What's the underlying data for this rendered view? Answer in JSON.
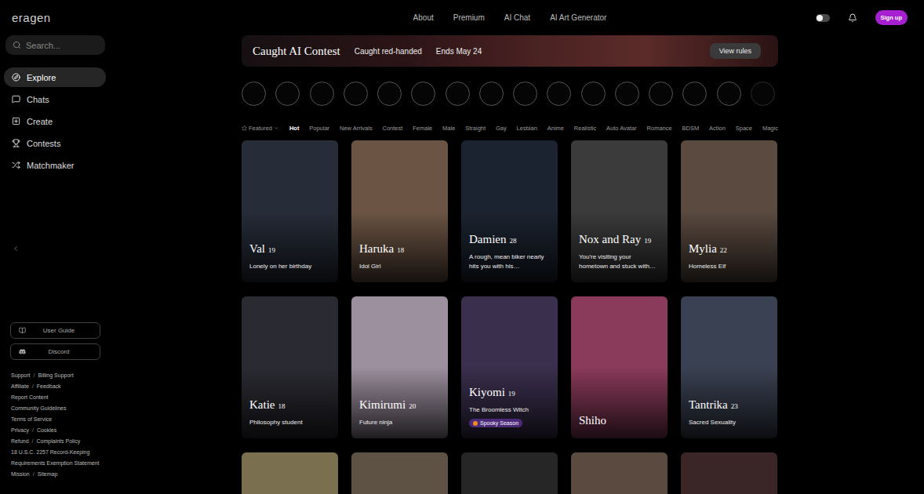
{
  "header": {
    "logo": "eragen",
    "nav": [
      "About",
      "Premium",
      "AI Chat",
      "AI Art Generator"
    ],
    "dark_mode": true,
    "signup": "Sign up"
  },
  "sidebar": {
    "search_placeholder": "Search...",
    "items": [
      {
        "label": "Explore",
        "selected": true
      },
      {
        "label": "Chats",
        "selected": false
      },
      {
        "label": "Create",
        "selected": false
      },
      {
        "label": "Contests",
        "selected": false
      },
      {
        "label": "Matchmaker",
        "selected": false
      }
    ],
    "buttons": [
      "User Guide",
      "Discord"
    ],
    "footer": {
      "separator": "/",
      "rows": [
        [
          "Support",
          "Billing Support"
        ],
        [
          "Affiliate",
          "Feedback"
        ],
        [
          "Report Content"
        ],
        [
          "Community Guidelines"
        ],
        [
          "Terms of Service"
        ],
        [
          "Privacy",
          "Cookies"
        ],
        [
          "Refund",
          "Complaints Policy"
        ],
        [
          "18 U.S.C. 2257 Record-Keeping Requirements Exemption Statement"
        ],
        [
          "Mission",
          "Sitemap"
        ]
      ]
    }
  },
  "banner": {
    "title": "Caught AI Contest",
    "subtitle": "Caught red-handed",
    "ends": "Ends May 24",
    "button": "View rules"
  },
  "avatar_circles": 16,
  "filters": {
    "sort": "Featured",
    "tabs": [
      {
        "label": "Hot",
        "selected": true
      },
      {
        "label": "Popular",
        "selected": false
      },
      {
        "label": "New Arrivals",
        "selected": false
      },
      {
        "label": "Contest",
        "selected": false
      },
      {
        "label": "Female",
        "selected": false
      },
      {
        "label": "Male",
        "selected": false
      },
      {
        "label": "Straight",
        "selected": false
      },
      {
        "label": "Gay",
        "selected": false
      },
      {
        "label": "Lesbian",
        "selected": false
      },
      {
        "label": "Anime",
        "selected": false
      },
      {
        "label": "Realistic",
        "selected": false
      },
      {
        "label": "Auto Avatar",
        "selected": false
      },
      {
        "label": "Romance",
        "selected": false
      },
      {
        "label": "BDSM",
        "selected": false
      },
      {
        "label": "Action",
        "selected": false
      },
      {
        "label": "Space",
        "selected": false
      },
      {
        "label": "Magic",
        "selected": false
      }
    ]
  },
  "cards": [
    {
      "kind": "character",
      "name": "Val",
      "age": "19",
      "description": "Lonely on her birthday"
    },
    {
      "kind": "character",
      "name": "Haruka",
      "age": "18",
      "description": "Idol Girl"
    },
    {
      "kind": "character",
      "name": "Damien",
      "age": "28",
      "description": "A rough, mean biker nearly hits you with his…"
    },
    {
      "kind": "character",
      "name": "Nox and Ray",
      "age": "19",
      "description": "You're visiting your hometown and stuck with…"
    },
    {
      "kind": "character",
      "name": "Mylia",
      "age": "22",
      "description": "Homeless Elf"
    },
    {
      "kind": "character",
      "name": "Katie",
      "age": "18",
      "description": "Philosophy student"
    },
    {
      "kind": "character",
      "name": "Kimirumi",
      "age": "20",
      "description": "Future ninja"
    },
    {
      "kind": "character",
      "name": "Kiyomi",
      "age": "19",
      "description": "The Broomless Witch",
      "badge": "Spooky Season"
    },
    {
      "kind": "character",
      "name": "Shiho"
    },
    {
      "kind": "character",
      "name": "Tantrika",
      "age": "23",
      "description": "Sacred Sexuality"
    },
    {
      "kind": "cut-off"
    },
    {
      "kind": "cut-off"
    },
    {
      "kind": "cut-off"
    },
    {
      "kind": "cut-off"
    },
    {
      "kind": "cut-off"
    }
  ]
}
